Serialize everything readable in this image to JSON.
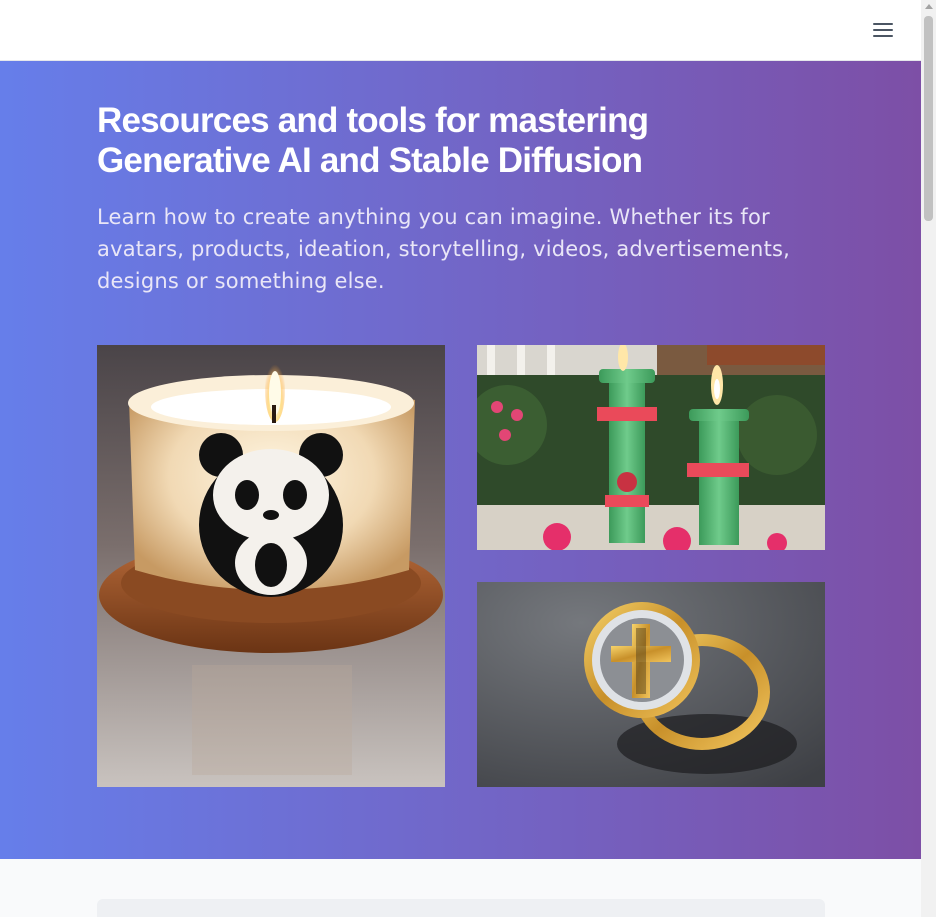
{
  "header": {
    "menu_icon": "hamburger-menu-icon"
  },
  "hero": {
    "title_line1": "Resources and tools for mastering",
    "title_line2": "Generative AI and Stable Diffusion",
    "subtitle": "Learn how to create anything you can imagine. Whether its for avatars, products, ideation, storytelling, videos, advertisements, designs or something else.",
    "gradient_start": "#667eea",
    "gradient_end": "#7d4fa6"
  },
  "gallery": {
    "images": [
      {
        "subject": "panda candle on wooden base"
      },
      {
        "subject": "two green candles with red flowers"
      },
      {
        "subject": "gold cross ring with diamonds"
      }
    ]
  }
}
